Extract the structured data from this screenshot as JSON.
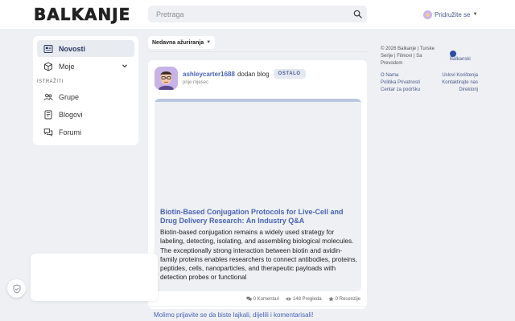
{
  "header": {
    "logo": "BALKANJE",
    "search_placeholder": "Pretraga",
    "join_label": "Pridružite se"
  },
  "sidebar": {
    "items": [
      {
        "label": "Novosti",
        "icon": "news-icon",
        "active": true
      },
      {
        "label": "Moje",
        "icon": "cube-icon",
        "expandable": true
      }
    ],
    "section_label": "ISTRAŽITI",
    "explore": [
      {
        "label": "Grupe",
        "icon": "groups-icon"
      },
      {
        "label": "Blogovi",
        "icon": "blog-icon"
      },
      {
        "label": "Forumi",
        "icon": "forum-icon"
      }
    ]
  },
  "feed": {
    "sort_label": "Nedavna ažuriranja",
    "post": {
      "user": "ashleycarter1688",
      "action": "dodan blog",
      "badge": "OSTALO",
      "time": "prije mjesec",
      "blog_title": "Biotin-Based Conjugation Protocols for Live-Cell and Drug Delivery Research: An Industry Q&A",
      "blog_excerpt": "Biotin-based conjugation remains a widely used strategy for labeling, detecting, isolating, and assembling biological molecules. The exceptionally strong interaction between biotin and avidin-family proteins enables researchers to connect antibodies, proteins, peptides, cells, nanoparticles, and therapeutic payloads with detection probes or functional",
      "stats": {
        "comments": "0 Komentari",
        "views": "148 Pregleda",
        "reviews": "0 Recenzije"
      }
    },
    "login_note": "Molimo prijavite se da biste lajkali, dijelili i komentarisali!"
  },
  "right_sidebar": {
    "copyright": "© 2026 Balkanje | Turske Serije | Filmovi | Sa Prevodom",
    "language": "Balkanski",
    "links_left": [
      "O Nama",
      "Politika Privatnosti",
      "Centar za podršku"
    ],
    "links_right": [
      "Uslovi Korištenja",
      "Kontaktirajte nas",
      "Direktorij"
    ]
  },
  "colors": {
    "accent": "#4a63b8",
    "background": "#eef0f3",
    "badge_bg": "#e4e8f2",
    "avatar_bg": "#c7b3ea"
  }
}
